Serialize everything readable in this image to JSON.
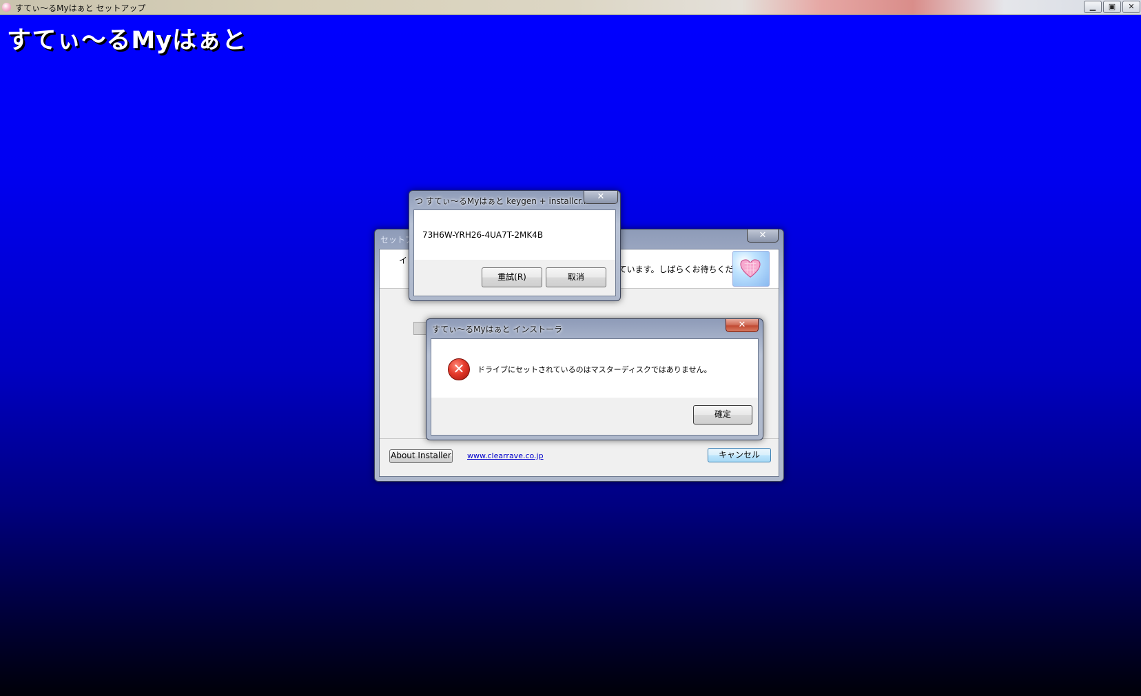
{
  "main_window": {
    "title": "すてぃ～るMyはぁと セットアップ",
    "minimize_glyph": "▁",
    "maximize_glyph": "▣",
    "close_glyph": "✕",
    "heading": "すてぃ～るMyはぁと"
  },
  "setup_dialog": {
    "title": "セットア",
    "close_glyph": "✕",
    "header_text_left": "イ",
    "header_text": "しています。しばらくお待ちくだ",
    "about_button": "About Installer",
    "site_link": "www.clearrave.co.jp",
    "cancel_button": "キャンセル"
  },
  "keygen_dialog": {
    "title": "つ すてぃ～るMyはぁと keygen + installcr...",
    "close_glyph": "✕",
    "serial": "73H6W-YRH26-4UA7T-2MK4B",
    "retry_button": "重試(R)",
    "cancel_button": "取消"
  },
  "error_dialog": {
    "title": "すてぃ～るMyはぁと インストーラ",
    "close_glyph": "✕",
    "icon_glyph": "✕",
    "message": "ドライブにセットされているのはマスターディスクではありません。",
    "ok_button": "確定"
  },
  "icons": {
    "app_icon": "heart-app-icon",
    "setup_logo": "heart-icon",
    "error_icon": "error-icon"
  },
  "colors": {
    "desktop_top": "#0000ff",
    "desktop_bottom": "#000008",
    "link": "#0000cc"
  }
}
